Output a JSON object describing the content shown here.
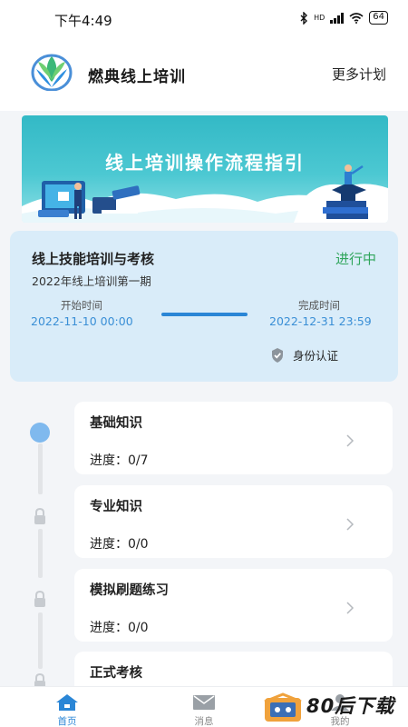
{
  "status_bar": {
    "time": "下午4:49",
    "network": "HD",
    "battery": "64"
  },
  "header": {
    "app_title": "燃典线上培训",
    "more_plans": "更多计划"
  },
  "banner": {
    "title": "线上培训操作流程指引"
  },
  "plan": {
    "title": "线上技能培训与考核",
    "status": "进行中",
    "subtitle": "2022年线上培训第一期",
    "start_label": "开始时间",
    "start_time": "2022-11-10 00:00",
    "end_label": "完成时间",
    "end_time": "2022-12-31 23:59",
    "verify_label": "身份认证"
  },
  "courses": [
    {
      "name": "基础知识",
      "progress": "进度：0/7"
    },
    {
      "name": "专业知识",
      "progress": "进度：0/0"
    },
    {
      "name": "模拟刷题练习",
      "progress": "进度：0/0"
    },
    {
      "name": "正式考核",
      "progress": ""
    }
  ],
  "tabbar": {
    "home": "首页",
    "messages": "消息",
    "mine": "我的"
  },
  "watermark": "80后下载",
  "colors": {
    "accent": "#2a86d6",
    "status_green": "#2fa55b",
    "card_bg": "#d9ecf9",
    "banner_teal": "#33b9c6"
  }
}
